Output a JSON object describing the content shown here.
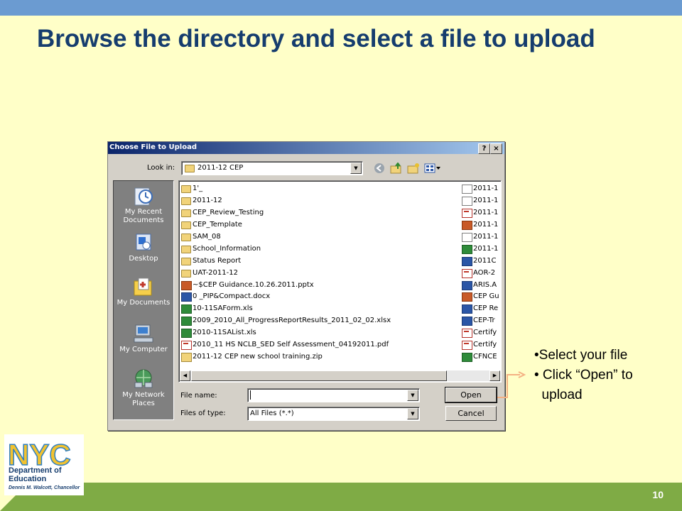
{
  "slide": {
    "title": "Browse the directory and select a file to upload",
    "page_number": "10",
    "bullets": [
      "•Select your file",
      "• Click “Open” to",
      "  upload"
    ]
  },
  "logo": {
    "text_nyc": "NYC",
    "line1": "Department of",
    "line2": "Education",
    "line3": "Dennis M. Walcott, Chancellor"
  },
  "dialog": {
    "title": "Choose File to Upload",
    "help_btn": "?",
    "close_btn": "×",
    "look_in_label": "Look in:",
    "look_in_value": "2011-12 CEP",
    "places": [
      {
        "label": "My Recent Documents",
        "icon": "recent-documents-icon"
      },
      {
        "label": "Desktop",
        "icon": "desktop-icon"
      },
      {
        "label": "My Documents",
        "icon": "my-documents-icon"
      },
      {
        "label": "My Computer",
        "icon": "my-computer-icon"
      },
      {
        "label": "My Network Places",
        "icon": "network-places-icon"
      }
    ],
    "files_col1": [
      {
        "name": "1'_",
        "type": "folder"
      },
      {
        "name": "2011-12",
        "type": "folder"
      },
      {
        "name": "CEP_Review_Testing",
        "type": "folder"
      },
      {
        "name": "CEP_Template",
        "type": "folder"
      },
      {
        "name": "SAM_08",
        "type": "folder"
      },
      {
        "name": "School_Information",
        "type": "folder"
      },
      {
        "name": "Status Report",
        "type": "folder"
      },
      {
        "name": "UAT-2011-12",
        "type": "folder"
      },
      {
        "name": "~$CEP Guidance.10.26.2011.pptx",
        "type": "ppt"
      },
      {
        "name": "0           _PIP&Compact.docx",
        "type": "word"
      },
      {
        "name": "10-11SAForm.xls",
        "type": "xls"
      },
      {
        "name": "2009_2010_All_ProgressReportResults_2011_02_02.xlsx",
        "type": "xls"
      },
      {
        "name": "2010-11SAList.xls",
        "type": "xls"
      },
      {
        "name": "2010_11 HS NCLB_SED Self Assessment_04192011.pdf",
        "type": "pdf"
      },
      {
        "name": "2011-12 CEP new school training.zip",
        "type": "zip"
      }
    ],
    "files_col2": [
      {
        "name": "2011-1",
        "type": "doc"
      },
      {
        "name": "2011-1",
        "type": "doc"
      },
      {
        "name": "2011-1",
        "type": "pdf"
      },
      {
        "name": "2011-1",
        "type": "ppt"
      },
      {
        "name": "2011-1",
        "type": "doc"
      },
      {
        "name": "2011-1",
        "type": "xls"
      },
      {
        "name": "2011C",
        "type": "word"
      },
      {
        "name": "AOR-2",
        "type": "pdf"
      },
      {
        "name": "ARIS.A",
        "type": "word"
      },
      {
        "name": "CEP Gu",
        "type": "ppt"
      },
      {
        "name": "CEP Re",
        "type": "word"
      },
      {
        "name": "CEP-Tr",
        "type": "word"
      },
      {
        "name": "Certify",
        "type": "pdf"
      },
      {
        "name": "Certify",
        "type": "pdf"
      },
      {
        "name": "CFNCE",
        "type": "xls"
      }
    ],
    "file_name_label": "File name:",
    "file_name_value": "",
    "files_of_type_label": "Files of type:",
    "files_of_type_value": "All Files (*.*)",
    "open_label": "Open",
    "cancel_label": "Cancel"
  },
  "colors": {
    "background": "#ffffc8",
    "title": "#163d6e",
    "top_bar": "#6b9bd1",
    "bottom_bar": "#7fab45",
    "dialog_title_start": "#0a246a"
  }
}
